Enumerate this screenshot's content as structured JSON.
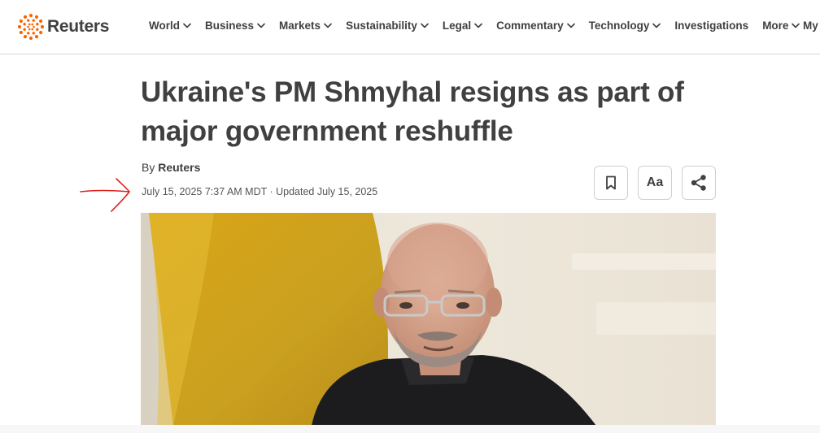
{
  "brand": {
    "name": "Reuters",
    "accent": "#fa6400"
  },
  "nav": {
    "items": [
      {
        "label": "World",
        "has_dropdown": true
      },
      {
        "label": "Business",
        "has_dropdown": true
      },
      {
        "label": "Markets",
        "has_dropdown": true
      },
      {
        "label": "Sustainability",
        "has_dropdown": true
      },
      {
        "label": "Legal",
        "has_dropdown": true
      },
      {
        "label": "Commentary",
        "has_dropdown": true
      },
      {
        "label": "Technology",
        "has_dropdown": true
      },
      {
        "label": "Investigations",
        "has_dropdown": false
      },
      {
        "label": "More",
        "has_dropdown": true
      }
    ],
    "account_label": "My"
  },
  "article": {
    "headline": "Ukraine's PM Shmyhal resigns as part of major government reshuffle",
    "byline_prefix": "By",
    "byline_author": "Reuters",
    "dateline": "July 15, 2025 7:37 AM MDT · Updated July 15, 2025",
    "tools": {
      "bookmark_icon": "bookmark-icon",
      "text_size_label": "Aa",
      "share_icon": "share-icon"
    }
  },
  "annotation": {
    "color": "#e02020"
  },
  "hero_image": {
    "subject": "man-with-glasses-in-front-of-flag"
  }
}
